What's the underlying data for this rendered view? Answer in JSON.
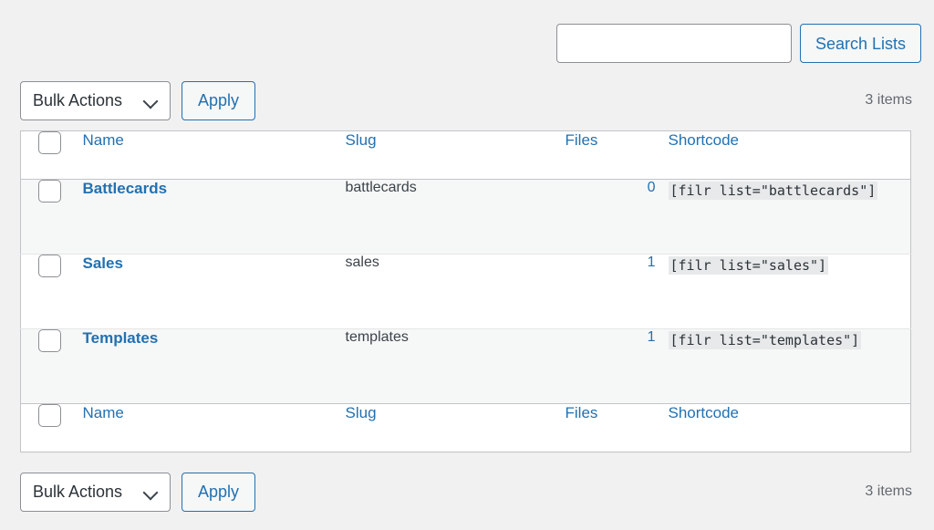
{
  "search": {
    "value": "",
    "placeholder": "",
    "button_label": "Search Lists"
  },
  "tablenav_top": {
    "bulk_actions_label": "Bulk Actions",
    "apply_label": "Apply",
    "displaying_num": "3 items"
  },
  "tablenav_bottom": {
    "bulk_actions_label": "Bulk Actions",
    "apply_label": "Apply",
    "displaying_num": "3 items"
  },
  "table": {
    "columns": {
      "name": "Name",
      "slug": "Slug",
      "files": "Files",
      "shortcode": "Shortcode"
    },
    "rows": [
      {
        "name": "Battlecards",
        "slug": "battlecards",
        "files": "0",
        "shortcode": "[filr list=\"battlecards\"]"
      },
      {
        "name": "Sales",
        "slug": "sales",
        "files": "1",
        "shortcode": "[filr list=\"sales\"]"
      },
      {
        "name": "Templates",
        "slug": "templates",
        "files": "1",
        "shortcode": "[filr list=\"templates\"]"
      }
    ]
  },
  "colors": {
    "link": "#2271b1",
    "page_background": "#f1f1f1",
    "table_background": "#ffffff",
    "alt_row_background": "#f6f7f7",
    "border": "#c3c4c7",
    "code_background": "#e8e9ea",
    "text": "#3c434a"
  }
}
